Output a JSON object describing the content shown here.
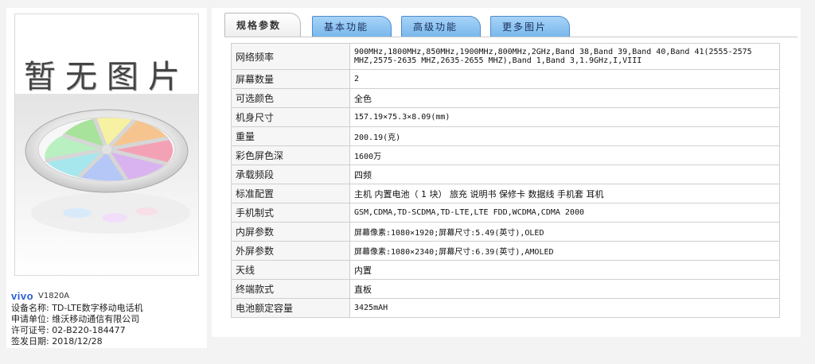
{
  "left": {
    "image_placeholder_text": "暂无图片",
    "brand_logo": "vivo",
    "model": "V1820A",
    "meta": [
      "设备名称: TD-LTE数字移动电话机",
      "申请单位: 维沃移动通信有限公司",
      "许可证号: 02-B220-184477",
      "签发日期: 2018/12/28"
    ]
  },
  "tabs": [
    {
      "label": "规格参数",
      "active": true
    },
    {
      "label": "基本功能",
      "active": false
    },
    {
      "label": "高级功能",
      "active": false
    },
    {
      "label": "更多图片",
      "active": false
    }
  ],
  "specs": [
    {
      "key": "网络频率",
      "value": "900MHz,1800MHz,850MHz,1900MHz,800MHz,2GHz,Band 38,Band 39,Band 40,Band 41(2555-2575 MHZ,2575-2635 MHZ,2635-2655 MHZ),Band 1,Band 3,1.9GHz,I,VIII"
    },
    {
      "key": "屏幕数量",
      "value": "2"
    },
    {
      "key": "可选颜色",
      "value": "全色"
    },
    {
      "key": "机身尺寸",
      "value": "157.19×75.3×8.09(mm)"
    },
    {
      "key": "重量",
      "value": "200.19(克)"
    },
    {
      "key": "彩色屏色深",
      "value": "1600万"
    },
    {
      "key": "承载频段",
      "value": "四频"
    },
    {
      "key": "标准配置",
      "value": "主机 内置电池（ 1 块） 旅充 说明书 保修卡 数据线 手机套 耳机"
    },
    {
      "key": "手机制式",
      "value": "GSM,CDMA,TD-SCDMA,TD-LTE,LTE FDD,WCDMA,CDMA 2000"
    },
    {
      "key": "内屏参数",
      "value": "屏幕像素:1080×1920;屏幕尺寸:5.49(英寸),OLED"
    },
    {
      "key": "外屏参数",
      "value": "屏幕像素:1080×2340;屏幕尺寸:6.39(英寸),AMOLED"
    },
    {
      "key": "天线",
      "value": "内置"
    },
    {
      "key": "终端款式",
      "value": "直板"
    },
    {
      "key": "电池额定容量",
      "value": "3425mAH"
    }
  ]
}
